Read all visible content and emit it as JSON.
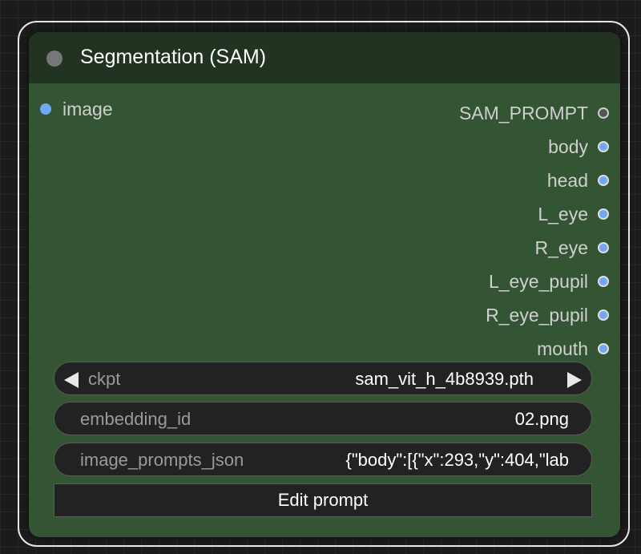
{
  "node": {
    "title": "Segmentation (SAM)",
    "input": {
      "label": "image",
      "color": "#6fa8f5"
    },
    "outputs": [
      {
        "label": "SAM_PROMPT",
        "color": "#555555",
        "border": "#cccccc"
      },
      {
        "label": "body",
        "color": "#6fa8f5",
        "border": "#dddddd"
      },
      {
        "label": "head",
        "color": "#6fa8f5",
        "border": "#dddddd"
      },
      {
        "label": "L_eye",
        "color": "#6fa8f5",
        "border": "#dddddd"
      },
      {
        "label": "R_eye",
        "color": "#6fa8f5",
        "border": "#dddddd"
      },
      {
        "label": "L_eye_pupil",
        "color": "#6fa8f5",
        "border": "#dddddd"
      },
      {
        "label": "R_eye_pupil",
        "color": "#6fa8f5",
        "border": "#dddddd"
      },
      {
        "label": "mouth",
        "color": "#6fa8f5",
        "border": "#dddddd"
      }
    ],
    "widgets": {
      "ckpt": {
        "name": "ckpt",
        "value": "sam_vit_h_4b8939.pth"
      },
      "embedding_id": {
        "name": "embedding_id",
        "value": "02.png"
      },
      "image_prompts_json": {
        "name": "image_prompts_json",
        "value": "{\"body\":[{\"x\":293,\"y\":404,\"lab"
      }
    },
    "button_label": "Edit prompt",
    "colors": {
      "body": "#335533",
      "title": "#223322",
      "widget": "#222222"
    }
  }
}
